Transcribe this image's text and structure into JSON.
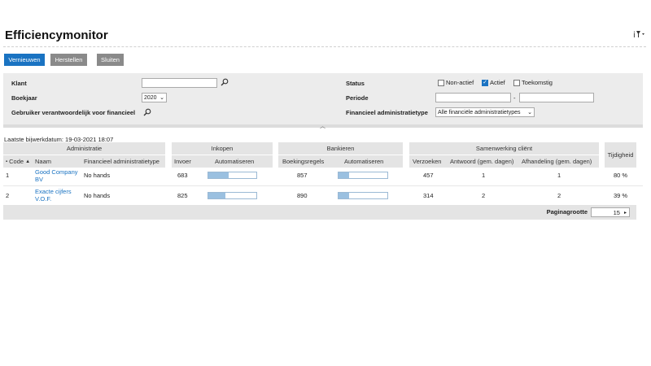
{
  "header": {
    "title": "Efficiencymonitor",
    "filter_icon": "filter-icon"
  },
  "toolbar": {
    "refresh_label": "Vernieuwen",
    "reset_label": "Herstellen",
    "close_label": "Sluiten"
  },
  "filters": {
    "client_label": "Klant",
    "client_value": "",
    "fiscal_year_label": "Boekjaar",
    "fiscal_year_value": "2020",
    "responsible_user_label": "Gebruiker verantwoordelijk voor financieel",
    "status_label": "Status",
    "status_options": [
      {
        "label": "Non-actief",
        "checked": false
      },
      {
        "label": "Actief",
        "checked": true
      },
      {
        "label": "Toekomstig",
        "checked": false
      }
    ],
    "period_label": "Periode",
    "period_from": "",
    "period_separator": "-",
    "period_to": "",
    "admin_type_label": "Financieel administratietype",
    "admin_type_value": "Alle financiële administratietypes"
  },
  "last_update": "Laatste bijwerkdatum: 19-03-2021 18:07",
  "table": {
    "groups": {
      "administration": "Administratie",
      "purchases": "Inkopen",
      "banking": "Bankieren",
      "collaboration": "Samenwerking cliënt",
      "timeliness": "Tijdigheid"
    },
    "columns": {
      "code": "Code",
      "name": "Naam",
      "admin_type": "Financieel administratietype",
      "entry": "Invoer",
      "automation_purchases": "Automatiseren",
      "booking_lines": "Boekingsregels",
      "automation_banking": "Automatiseren",
      "requests": "Verzoeken",
      "response": "Antwoord (gem. dagen)",
      "handling": "Afhandeling (gem. dagen)"
    },
    "rows": [
      {
        "code": "1",
        "name_line1": "Good Company",
        "name_line2": "BV",
        "admin_type": "No hands",
        "entry": "683",
        "purchase_automation": 0.42,
        "booking_lines": "857",
        "bank_automation": 0.22,
        "requests": "457",
        "response": "1",
        "handling": "1",
        "timeliness": "80 %"
      },
      {
        "code": "2",
        "name_line1": "Exacte cijfers",
        "name_line2": "V.O.F.",
        "admin_type": "No hands",
        "entry": "825",
        "purchase_automation": 0.36,
        "booking_lines": "890",
        "bank_automation": 0.22,
        "requests": "314",
        "response": "2",
        "handling": "2",
        "timeliness": "39 %"
      }
    ]
  },
  "footer": {
    "page_size_label": "Paginagrootte",
    "page_size_value": "15"
  },
  "colors": {
    "primary": "#1a73c2",
    "secondary_button": "#8a8a8a",
    "bar_fill": "#9ac0e0",
    "panel": "#ececec"
  }
}
